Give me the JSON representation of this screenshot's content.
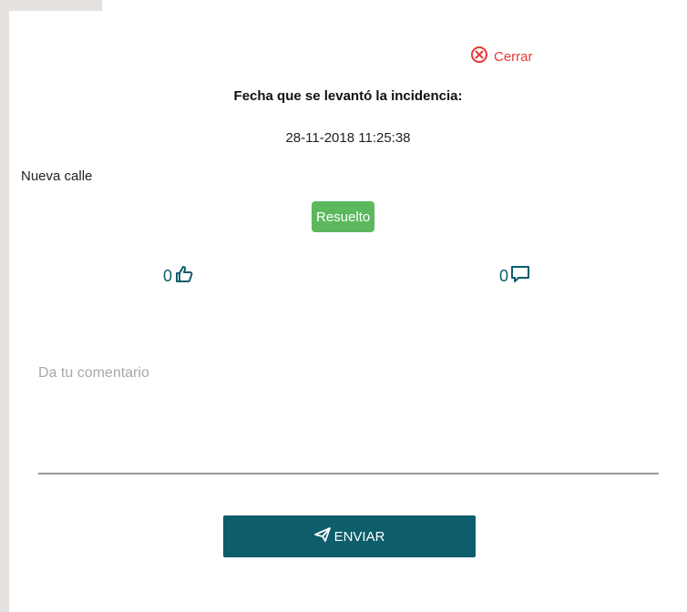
{
  "header": {
    "close_label": "Cerrar",
    "close_icon": "close-circle-icon"
  },
  "incident": {
    "date_heading": "Fecha que se levantó la incidencia:",
    "date_value": "28-11-2018 11:25:38",
    "description": "Nueva calle",
    "status": "Resuelto"
  },
  "counters": {
    "likes": "0",
    "likes_icon": "thumbs-up-icon",
    "comments": "0",
    "comments_icon": "comment-icon"
  },
  "comment_form": {
    "placeholder": "Da tu comentario",
    "value": "",
    "send_label": "ENVIAR",
    "send_icon": "paper-plane-icon"
  },
  "colors": {
    "accent": "#0d5d6b",
    "status_green": "#5cb85c",
    "close_red": "#e53935"
  }
}
